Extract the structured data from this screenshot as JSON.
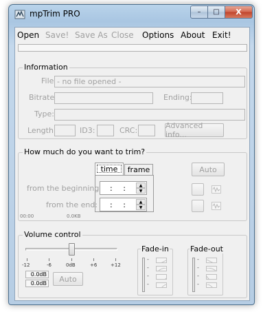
{
  "window": {
    "title": "mpTrim PRO",
    "controls": {
      "minimize": "–",
      "maximize": "□",
      "close": "X"
    }
  },
  "menu": {
    "items": [
      {
        "label": "Open",
        "enabled": true
      },
      {
        "label": "Save!",
        "enabled": false
      },
      {
        "label": "Save As",
        "enabled": false
      },
      {
        "label": "Close",
        "enabled": false
      },
      {
        "label": "Options",
        "enabled": true
      },
      {
        "label": "About",
        "enabled": true
      },
      {
        "label": "Exit!",
        "enabled": true
      }
    ]
  },
  "progress": {
    "value": 0
  },
  "information": {
    "title": "Information",
    "file_label": "File:",
    "file_value": "- no file opened -",
    "bitrate_label": "Bitrate:",
    "ending_label": "Ending:",
    "type_label": "Type:",
    "length_label": "Length:",
    "id3_label": "ID3:",
    "crc_label": "CRC:",
    "advanced_button": "Advanced info..."
  },
  "trim": {
    "title": "How much do you want to trim?",
    "tabs": [
      "time",
      "frame"
    ],
    "active_tab": "time",
    "auto_button": "Auto",
    "from_beginning_label": "from the beginning:",
    "from_end_label": "from the end:",
    "beginning_value": ":   :",
    "end_value": ":   :",
    "time_readout": "00:00",
    "size_readout": "0.0KB"
  },
  "volume": {
    "title": "Volume control",
    "scale": [
      "-12",
      "-6",
      "0dB",
      "+6",
      "+12"
    ],
    "level_db": 0,
    "db_readout_1": "0.0dB",
    "db_readout_2": "0.0dB",
    "auto_button": "Auto",
    "fade_in_title": "Fade-in",
    "fade_out_title": "Fade-out"
  },
  "colors": {
    "titlebar": "#b9d3ea",
    "client": "#f0f0f0",
    "disabled_text": "#a0a0a0"
  }
}
